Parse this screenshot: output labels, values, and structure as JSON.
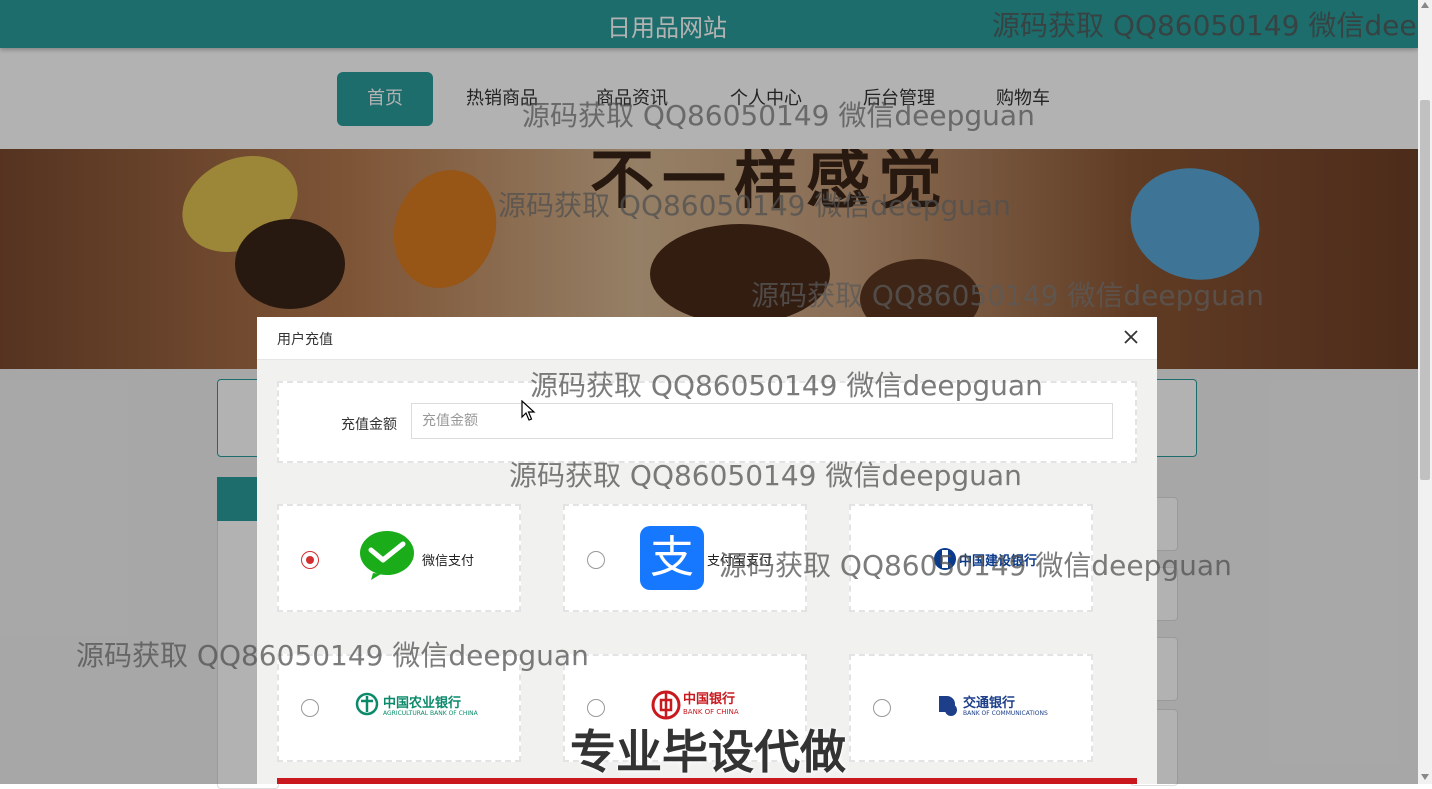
{
  "header": {
    "site_title": "日用品网站"
  },
  "nav": {
    "items": [
      "首页",
      "热销商品",
      "商品资讯",
      "个人中心",
      "后台管理",
      "购物车"
    ],
    "active_index": 0
  },
  "banner": {
    "text": "不一样感觉"
  },
  "modal": {
    "title": "用户充值",
    "amount_label": "充值金额",
    "amount_placeholder": "充值金额",
    "amount_value": "",
    "payment_options": [
      {
        "label": "微信支付",
        "selected": true
      },
      {
        "label": "支付宝支付",
        "selected": false
      },
      {
        "label": "中国建设银行",
        "selected": false
      },
      {
        "label": "中国农业银行",
        "selected": false
      },
      {
        "label": "中国银行",
        "selected": false
      },
      {
        "label": "交通银行",
        "selected": false
      }
    ],
    "logo_text": {
      "alipay_char": "支",
      "abc_en": "AGRICULTURAL BANK OF CHINA",
      "boc_en": "BANK OF CHINA",
      "bocom_en": "BANK OF COMMUNICATIONS"
    }
  },
  "watermarks": {
    "repeated": "源码获取 QQ86050149 微信deepguan",
    "top_partial": "源码获取 QQ86050149 微信dee",
    "promo": "专业毕设代做"
  },
  "colors": {
    "primary": "#2a9d9c",
    "radio_selected": "#d32f2f",
    "wechat_green": "#1aad19",
    "alipay_blue": "#1677ff",
    "bank_red": "#c9191e",
    "abc_green": "#0a8a6a",
    "bocom_blue": "#1d3f8a",
    "ccb_blue": "#0a3a8c"
  }
}
